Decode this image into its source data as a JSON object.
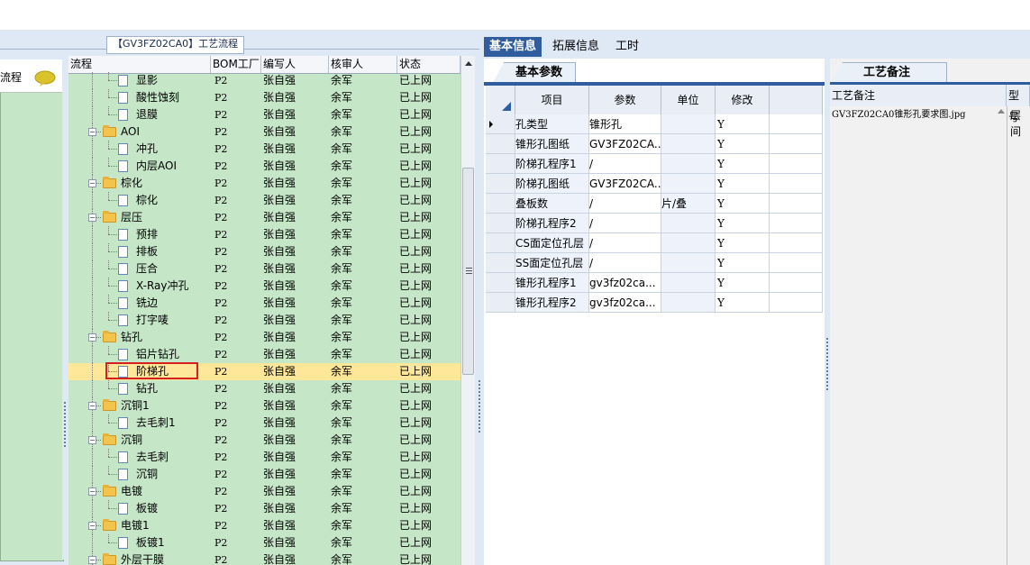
{
  "left_group_title": "【GV3FZ02CA0】工艺流程",
  "left_pane_label": "流程",
  "tree": {
    "columns": [
      "流程",
      "BOM工厂",
      "编写人",
      "核审人",
      "状态"
    ],
    "rows": [
      {
        "name": "显影",
        "type": "doc",
        "bom": "P2",
        "writer": "张自强",
        "reviewer": "余军",
        "status": "已上网"
      },
      {
        "name": "酸性蚀刻",
        "type": "doc",
        "bom": "P2",
        "writer": "张自强",
        "reviewer": "余军",
        "status": "已上网"
      },
      {
        "name": "退膜",
        "type": "doc",
        "bom": "P2",
        "writer": "张自强",
        "reviewer": "余军",
        "status": "已上网"
      },
      {
        "name": "AOI",
        "type": "folder",
        "bom": "P2",
        "writer": "张自强",
        "reviewer": "余军",
        "status": "已上网"
      },
      {
        "name": "冲孔",
        "type": "doc",
        "bom": "P2",
        "writer": "张自强",
        "reviewer": "余军",
        "status": "已上网"
      },
      {
        "name": "内层AOI",
        "type": "doc",
        "bom": "P2",
        "writer": "张自强",
        "reviewer": "余军",
        "status": "已上网"
      },
      {
        "name": "棕化",
        "type": "folder",
        "bom": "P2",
        "writer": "张自强",
        "reviewer": "余军",
        "status": "已上网"
      },
      {
        "name": "棕化",
        "type": "doc",
        "bom": "P2",
        "writer": "张自强",
        "reviewer": "余军",
        "status": "已上网"
      },
      {
        "name": "层压",
        "type": "folder",
        "bom": "P2",
        "writer": "张自强",
        "reviewer": "余军",
        "status": "已上网"
      },
      {
        "name": "预排",
        "type": "doc",
        "bom": "P2",
        "writer": "张自强",
        "reviewer": "余军",
        "status": "已上网"
      },
      {
        "name": "排板",
        "type": "doc",
        "bom": "P2",
        "writer": "张自强",
        "reviewer": "余军",
        "status": "已上网"
      },
      {
        "name": "压合",
        "type": "doc",
        "bom": "P2",
        "writer": "张自强",
        "reviewer": "余军",
        "status": "已上网"
      },
      {
        "name": "X-Ray冲孔",
        "type": "doc",
        "bom": "P2",
        "writer": "张自强",
        "reviewer": "余军",
        "status": "已上网"
      },
      {
        "name": "铣边",
        "type": "doc",
        "bom": "P2",
        "writer": "张自强",
        "reviewer": "余军",
        "status": "已上网"
      },
      {
        "name": "打字唛",
        "type": "doc",
        "bom": "P2",
        "writer": "张自强",
        "reviewer": "余军",
        "status": "已上网"
      },
      {
        "name": "钻孔",
        "type": "folder",
        "bom": "P2",
        "writer": "张自强",
        "reviewer": "余军",
        "status": "已上网"
      },
      {
        "name": "铝片钻孔",
        "type": "doc",
        "bom": "P2",
        "writer": "张自强",
        "reviewer": "余军",
        "status": "已上网"
      },
      {
        "name": "阶梯孔",
        "type": "doc",
        "bom": "P2",
        "writer": "张自强",
        "reviewer": "余军",
        "status": "已上网",
        "selected": true
      },
      {
        "name": "钻孔",
        "type": "doc",
        "bom": "P2",
        "writer": "张自强",
        "reviewer": "余军",
        "status": "已上网"
      },
      {
        "name": "沉铜1",
        "type": "folder",
        "bom": "P2",
        "writer": "张自强",
        "reviewer": "余军",
        "status": "已上网"
      },
      {
        "name": "去毛刺1",
        "type": "doc",
        "bom": "P2",
        "writer": "张自强",
        "reviewer": "余军",
        "status": "已上网"
      },
      {
        "name": "沉铜",
        "type": "folder",
        "bom": "P2",
        "writer": "张自强",
        "reviewer": "余军",
        "status": "已上网"
      },
      {
        "name": "去毛刺",
        "type": "doc",
        "bom": "P2",
        "writer": "张自强",
        "reviewer": "余军",
        "status": "已上网"
      },
      {
        "name": "沉铜",
        "type": "doc",
        "bom": "P2",
        "writer": "张自强",
        "reviewer": "余军",
        "status": "已上网"
      },
      {
        "name": "电镀",
        "type": "folder",
        "bom": "P2",
        "writer": "张自强",
        "reviewer": "余军",
        "status": "已上网"
      },
      {
        "name": "板镀",
        "type": "doc",
        "bom": "P2",
        "writer": "张自强",
        "reviewer": "余军",
        "status": "已上网"
      },
      {
        "name": "电镀1",
        "type": "folder",
        "bom": "P2",
        "writer": "张自强",
        "reviewer": "余军",
        "status": "已上网"
      },
      {
        "name": "板镀1",
        "type": "doc",
        "bom": "P2",
        "writer": "张自强",
        "reviewer": "余军",
        "status": "已上网"
      },
      {
        "name": "外层干膜",
        "type": "folder",
        "bom": "P2",
        "writer": "张自强",
        "reviewer": "余军",
        "status": "已上网"
      }
    ]
  },
  "right_tabs": [
    "基本信息",
    "拓展信息",
    "工时"
  ],
  "basic_params": {
    "tab_label": "基本参数",
    "columns": [
      "项目",
      "参数",
      "单位",
      "修改"
    ],
    "rows": [
      {
        "item": "孔类型",
        "param": "锥形孔",
        "unit": "",
        "mod": "Y"
      },
      {
        "item": "锥形孔图纸",
        "param": "GV3FZ02CA...",
        "unit": "",
        "mod": "Y"
      },
      {
        "item": "阶梯孔程序1",
        "param": "/",
        "unit": "",
        "mod": "Y"
      },
      {
        "item": "阶梯孔图纸",
        "param": "GV3FZ02CA...",
        "unit": "",
        "mod": "Y"
      },
      {
        "item": "叠板数",
        "param": "/",
        "unit": "片/叠",
        "mod": "Y"
      },
      {
        "item": "阶梯孔程序2",
        "param": "/",
        "unit": "",
        "mod": "Y"
      },
      {
        "item": "CS面定位孔层",
        "param": "/",
        "unit": "",
        "mod": "Y"
      },
      {
        "item": "SS面定位孔层",
        "param": "/",
        "unit": "",
        "mod": "Y"
      },
      {
        "item": "锥形孔程序1",
        "param": "gv3fz02ca...",
        "unit": "",
        "mod": "Y"
      },
      {
        "item": "锥形孔程序2",
        "param": "gv3fz02ca...",
        "unit": "",
        "mod": "Y"
      }
    ]
  },
  "process_notes": {
    "tab_label": "工艺备注",
    "columns": [
      "工艺备注",
      "型号"
    ],
    "value": "GV3FZ02CA0锥形孔要求图.jpg",
    "col2_value": "层间"
  }
}
